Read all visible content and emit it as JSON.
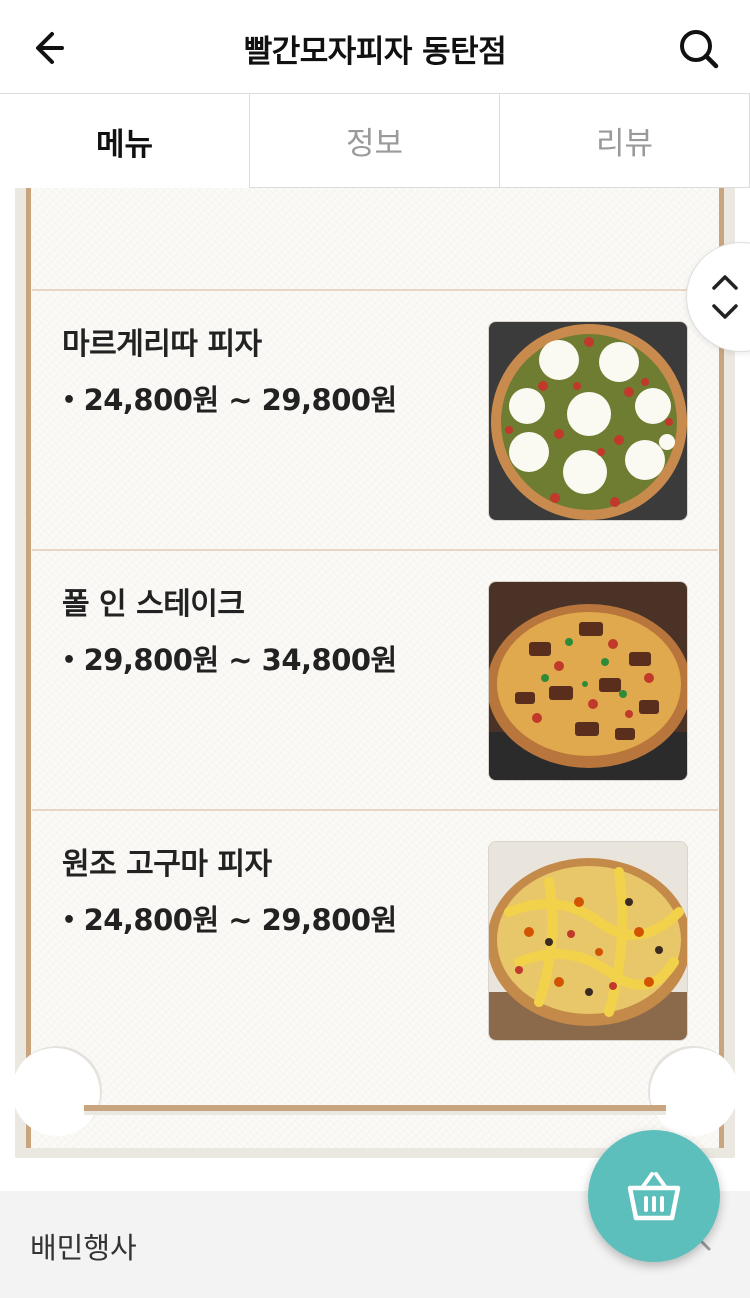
{
  "header": {
    "title": "빨간모자피자 동탄점",
    "back_icon": "arrow-left-icon",
    "search_icon": "search-icon"
  },
  "tabs": [
    {
      "label": "메뉴",
      "active": true
    },
    {
      "label": "정보",
      "active": false
    },
    {
      "label": "리뷰",
      "active": false
    }
  ],
  "menu": {
    "items": [
      {
        "name": "마르게리따 피자",
        "price": "24,800원 ~ 29,800원",
        "image": "margherita-pizza-photo"
      },
      {
        "name": "폴 인 스테이크",
        "price": "29,800원 ~ 34,800원",
        "image": "steak-pizza-photo"
      },
      {
        "name": "원조 고구마 피자",
        "price": "24,800원 ~ 29,800원",
        "image": "sweet-potato-pizza-photo"
      }
    ],
    "price_bullet": "•"
  },
  "scroll_toggle": {
    "icon": "chevron-up-down-icon"
  },
  "bottom_bar": {
    "label": "배민행사",
    "icon": "chevron-up-icon"
  },
  "cart_button": {
    "icon": "basket-icon"
  },
  "colors": {
    "accent_teal": "#5cbfbc",
    "board_border": "#c9a57f",
    "divider": "#e6d6c2"
  }
}
